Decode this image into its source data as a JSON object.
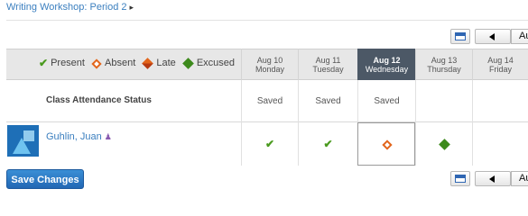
{
  "breadcrumb": {
    "text": "Writing Workshop: Period 2",
    "arrow": "▸"
  },
  "nav": {
    "date_label": "Au"
  },
  "legend": {
    "present": "Present",
    "absent": "Absent",
    "late": "Late",
    "excused": "Excused"
  },
  "days": [
    {
      "date": "Aug 10",
      "weekday": "Monday",
      "status": "Saved",
      "mark": "present",
      "active": false
    },
    {
      "date": "Aug 11",
      "weekday": "Tuesday",
      "status": "Saved",
      "mark": "present",
      "active": false
    },
    {
      "date": "Aug 12",
      "weekday": "Wednesday",
      "status": "Saved",
      "mark": "absent",
      "active": true
    },
    {
      "date": "Aug 13",
      "weekday": "Thursday",
      "status": "",
      "mark": "excused",
      "active": false
    },
    {
      "date": "Aug 14",
      "weekday": "Friday",
      "status": "",
      "mark": "",
      "active": false
    }
  ],
  "status_row_label": "Class Attendance Status",
  "student": {
    "name": "Guhlin, Juan"
  },
  "save_button": "Save Changes",
  "colors": {
    "link": "#3b7fbf",
    "present": "#4a9a1e",
    "absent": "#e2651b",
    "excused": "#3d8a1c",
    "active_header": "#4c5866",
    "save_button": "#2a74c0"
  },
  "icons": {
    "calendar": "calendar-icon",
    "previous": "arrow-left-icon",
    "present": "checkmark-icon",
    "absent": "hollow-diamond-icon",
    "late": "half-diamond-icon",
    "excused": "solid-diamond-icon",
    "student": "person-icon"
  }
}
